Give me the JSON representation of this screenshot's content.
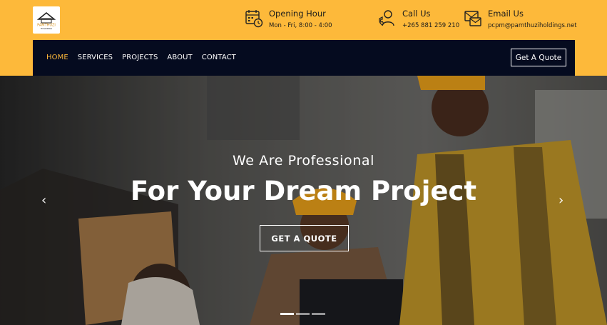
{
  "brand": {
    "logo_text": "PAMTHUZI",
    "logo_sub": "HOLDINGS"
  },
  "header": {
    "hours": {
      "title": "Opening Hour",
      "detail": "Mon - Fri, 8:00 - 4:00",
      "icon": "calendar-clock-icon"
    },
    "call": {
      "title": "Call Us",
      "detail": "+265 881 259 210",
      "icon": "call-support-icon"
    },
    "email": {
      "title": "Email Us",
      "detail": "pcpm@pamthuziholdings.net",
      "icon": "email-icon"
    }
  },
  "nav": {
    "items": [
      {
        "label": "HOME",
        "active": true
      },
      {
        "label": "SERVICES",
        "active": false
      },
      {
        "label": "PROJECTS",
        "active": false
      },
      {
        "label": "ABOUT",
        "active": false
      },
      {
        "label": "CONTACT",
        "active": false
      }
    ],
    "quote_button": "Get A Quote"
  },
  "hero": {
    "subtitle": "We Are Professional",
    "title": "For Your Dream Project",
    "button": "GET A QUOTE",
    "prev_arrow": "‹",
    "next_arrow": "›",
    "slides": 3,
    "active_slide": 1
  },
  "colors": {
    "accent": "#fdb93a",
    "navy": "#050b1f"
  }
}
